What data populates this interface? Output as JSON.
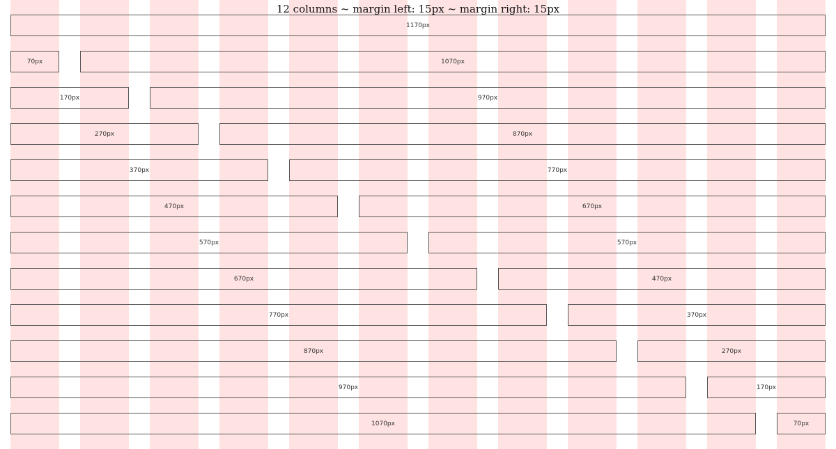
{
  "title": "12 columns ~ margin left: 15px ~ margin right: 15px",
  "colors": {
    "column": "#ffe3e3",
    "border": "#555555",
    "text": "#333333"
  },
  "rows": [
    {
      "cells": [
        {
          "label": "1170px",
          "span": 12
        }
      ]
    },
    {
      "cells": [
        {
          "label": "70px",
          "span": 1
        },
        {
          "label": "1070px",
          "span": 11
        }
      ]
    },
    {
      "cells": [
        {
          "label": "170px",
          "span": 2
        },
        {
          "label": "970px",
          "span": 10
        }
      ]
    },
    {
      "cells": [
        {
          "label": "270px",
          "span": 3
        },
        {
          "label": "870px",
          "span": 9
        }
      ]
    },
    {
      "cells": [
        {
          "label": "370px",
          "span": 4
        },
        {
          "label": "770px",
          "span": 8
        }
      ]
    },
    {
      "cells": [
        {
          "label": "470px",
          "span": 5
        },
        {
          "label": "670px",
          "span": 7
        }
      ]
    },
    {
      "cells": [
        {
          "label": "570px",
          "span": 6
        },
        {
          "label": "570px",
          "span": 6
        }
      ]
    },
    {
      "cells": [
        {
          "label": "670px",
          "span": 7
        },
        {
          "label": "470px",
          "span": 5
        }
      ]
    },
    {
      "cells": [
        {
          "label": "770px",
          "span": 8
        },
        {
          "label": "370px",
          "span": 4
        }
      ]
    },
    {
      "cells": [
        {
          "label": "870px",
          "span": 9
        },
        {
          "label": "270px",
          "span": 3
        }
      ]
    },
    {
      "cells": [
        {
          "label": "970px",
          "span": 10
        },
        {
          "label": "170px",
          "span": 2
        }
      ]
    },
    {
      "cells": [
        {
          "label": "1070px",
          "span": 11
        },
        {
          "label": "70px",
          "span": 1
        }
      ]
    }
  ]
}
